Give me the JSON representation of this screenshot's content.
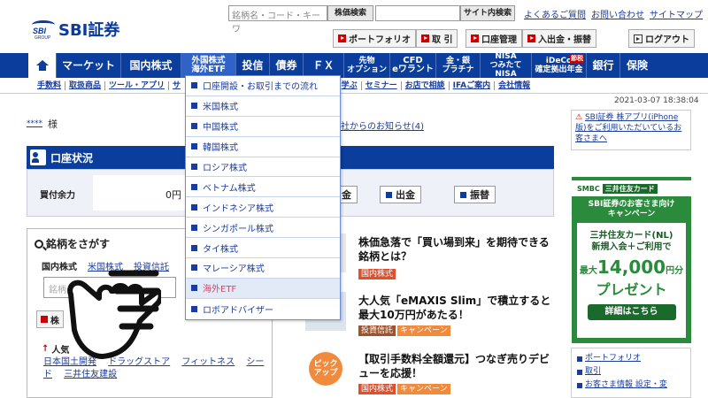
{
  "header": {
    "logo_small": "SBI",
    "logo_group": "GROUP",
    "logo_name": "SBI証券",
    "stock_search_placeholder": "銘柄名・コード・キーワ",
    "stock_search_button": "株価検索",
    "site_search_button": "サイト内検索",
    "links": [
      "よくあるご質問",
      "お問い合わせ",
      "サイトマップ"
    ],
    "buttons": [
      "ポートフォリオ",
      "取 引",
      "口座管理",
      "入出金・振替"
    ],
    "logout": "ログアウト"
  },
  "nav": {
    "items": [
      {
        "label": "マーケット"
      },
      {
        "label": "国内株式"
      },
      {
        "label": "外国株式\n海外ETF"
      },
      {
        "label": "投信"
      },
      {
        "label": "債券"
      },
      {
        "label": "ＦＸ"
      },
      {
        "label": "先物\nオプション"
      },
      {
        "label": "CFD\neワラント"
      },
      {
        "label": "金・銀\nプラチナ"
      },
      {
        "label": "NISA\nつみたてNISA"
      },
      {
        "label": "iDeCo\n確定拠出年金"
      },
      {
        "label": "銀行"
      },
      {
        "label": "保険"
      }
    ],
    "ideco_badge": "節税"
  },
  "subnav": [
    "手数料",
    "取扱商品",
    "ツール・アプリ",
    "サ",
    "ーン",
    "学ぶ",
    "セミナー",
    "お店で相談",
    "IFAご案内",
    "会社情報"
  ],
  "timestamp": "2021-03-07 18:38:04",
  "greeting": {
    "stars": "****",
    "suffix": "様"
  },
  "notice": "社からのお知らせ(4)",
  "account": {
    "title": "口座状況",
    "label": "買付余力",
    "value": "0円",
    "buttons": [
      "金",
      "出金",
      "振替"
    ]
  },
  "stock_search": {
    "title": "銘柄をさがす",
    "tabs": [
      "国内株式",
      "米国株式",
      "投資信託"
    ],
    "input_placeholder": "銘柄",
    "buttons": [
      "株",
      "",
      ""
    ],
    "popular_label": "人気",
    "popular_suffix": "ド",
    "keywords": [
      "日本国土開発",
      "ドラッグストア",
      "フィットネス",
      "シード",
      "三井住友建設"
    ]
  },
  "news": [
    {
      "title": "株価急落で「買い場到来」を期待できる銘柄とは？",
      "tags": [
        "国内株式"
      ]
    },
    {
      "title": "大人気「eMAXIS Slim」で積立すると最大10万円があたる！",
      "tags": [
        "投資信託",
        "キャンペーン"
      ]
    },
    {
      "title": "【取引手数料全額還元】つなぎ売りデビューを応援！",
      "tags": [
        "国内株式",
        "キャンペーン"
      ],
      "badge": "ピック\nアップ"
    }
  ],
  "app_banner": "SBI証券 株アプリ(iPhone版)をご利用いただいているお客さまへ",
  "ad": {
    "brand": "SMBC",
    "card": "三井住友カード",
    "line1": "SBI証券のお客さま向け\nキャンペーン",
    "line2": "三井住友カード(NL)\n新規入会＋ご利用で",
    "prefix": "最大",
    "amount": "14,000",
    "unit": "円分",
    "present": "プレゼント",
    "detail": "詳細はこちら"
  },
  "quick_links": [
    "ポートフォリオ",
    "取引",
    "お客さま情報 設定・変"
  ],
  "dropdown": {
    "items": [
      {
        "label": "口座開設・お取引までの流れ"
      },
      {
        "label": "米国株式"
      },
      {
        "label": "中国株式"
      },
      {
        "label": "韓国株式"
      },
      {
        "label": "ロシア株式"
      },
      {
        "label": "ベトナム株式"
      },
      {
        "label": "インドネシア株式"
      },
      {
        "label": "シンガポール株式"
      },
      {
        "label": "タイ株式"
      },
      {
        "label": "マレーシア株式"
      },
      {
        "label": "海外ETF"
      },
      {
        "label": "ロボアドバイザー"
      }
    ],
    "hovered": "海外ETF"
  },
  "colors": {
    "brand_blue": "#0a3d9c",
    "accent_red": "#cc0000",
    "hover_pink": "#d0486a",
    "ad_green": "#2a8b3c"
  }
}
